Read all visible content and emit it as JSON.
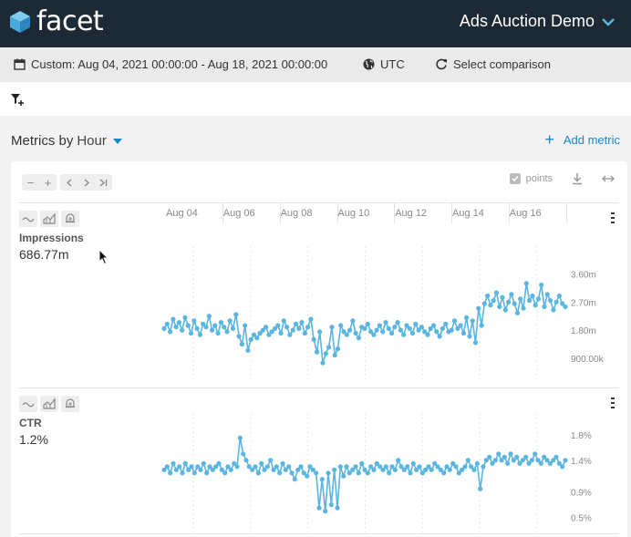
{
  "header": {
    "logo_text": "facet",
    "datacube_title": "Ads Auction Demo"
  },
  "timebar": {
    "range_label": "Custom: Aug 04, 2021 00:00:00 - Aug 18, 2021 00:00:00",
    "timezone": "UTC",
    "comparison_label": "Select comparison"
  },
  "metrics_header": {
    "title": "Metrics by",
    "split_dimension": "Hour",
    "add_metric_label": "Add metric"
  },
  "toolbar": {
    "points_label": "points"
  },
  "time_axis": {
    "labels": [
      "Aug 04",
      "Aug 06",
      "Aug 08",
      "Aug 10",
      "Aug 12",
      "Aug 14",
      "Aug 16"
    ]
  },
  "metrics": [
    {
      "name": "Impressions",
      "total": "686.77m",
      "chart_data": {
        "type": "line",
        "series_color": "#5ab5e0",
        "x_range": [
          "2021-08-04",
          "2021-08-18"
        ],
        "y_tick_labels": [
          "3.60m",
          "2.70m",
          "1.80m",
          "900.00k"
        ],
        "y_tick_values": [
          3600000,
          2700000,
          1800000,
          900000
        ],
        "ylim": [
          400000,
          4200000
        ],
        "values": [
          1850000,
          2000000,
          1750000,
          2150000,
          1900000,
          2050000,
          1800000,
          2200000,
          1950000,
          1700000,
          2100000,
          1850000,
          1650000,
          2000000,
          1900000,
          2250000,
          1800000,
          1950000,
          1700000,
          2050000,
          1900000,
          1750000,
          2100000,
          1850000,
          2300000,
          1600000,
          1350000,
          1950000,
          1150000,
          1500000,
          1650000,
          1550000,
          1700000,
          1800000,
          1900000,
          1650000,
          1750000,
          1850000,
          1950000,
          1700000,
          2100000,
          1900000,
          1650000,
          1800000,
          2000000,
          1850000,
          2050000,
          1700000,
          1900000,
          2150000,
          1500000,
          1100000,
          1750000,
          750000,
          1050000,
          1250000,
          1900000,
          1000000,
          1200000,
          1950000,
          1750000,
          1650000,
          1800000,
          2100000,
          1700000,
          1550000,
          1900000,
          1850000,
          2000000,
          1750000,
          1650000,
          1800000,
          1950000,
          1750000,
          2050000,
          1850000,
          1700000,
          1900000,
          2050000,
          1800000,
          1650000,
          1950000,
          1850000,
          1700000,
          2000000,
          1800000,
          1900000,
          1750000,
          1650000,
          1850000,
          1950000,
          1750000,
          1600000,
          1850000,
          2000000,
          1750000,
          1800000,
          2100000,
          1850000,
          1950000,
          1700000,
          2200000,
          1600000,
          2100000,
          1400000,
          2500000,
          1950000,
          2650000,
          2900000,
          2600000,
          2750000,
          3000000,
          2550000,
          2850000,
          2450000,
          2700000,
          2950000,
          2650000,
          2350000,
          2800000,
          2500000,
          3300000,
          2750000,
          2900000,
          2600000,
          2800000,
          3250000,
          2550000,
          2950000,
          2750000,
          2450000,
          2700000,
          2900000,
          2650000,
          2550000
        ]
      }
    },
    {
      "name": "CTR",
      "total": "1.2%",
      "chart_data": {
        "type": "line",
        "series_color": "#5ab5e0",
        "x_range": [
          "2021-08-04",
          "2021-08-18"
        ],
        "y_tick_labels": [
          "1.8%",
          "1.4%",
          "0.9%",
          "0.5%"
        ],
        "y_tick_values": [
          1.8,
          1.4,
          0.9,
          0.5
        ],
        "ylim": [
          0.35,
          2.0
        ],
        "values": [
          1.25,
          1.3,
          1.2,
          1.35,
          1.25,
          1.3,
          1.2,
          1.35,
          1.25,
          1.3,
          1.2,
          1.3,
          1.25,
          1.35,
          1.2,
          1.3,
          1.25,
          1.3,
          1.35,
          1.25,
          1.2,
          1.3,
          1.25,
          1.35,
          1.3,
          1.75,
          1.5,
          1.4,
          1.3,
          1.25,
          1.3,
          1.2,
          1.35,
          1.25,
          1.3,
          1.4,
          1.25,
          1.3,
          1.2,
          1.35,
          1.25,
          1.3,
          1.2,
          1.1,
          1.25,
          1.3,
          1.2,
          1.15,
          1.3,
          1.25,
          1.2,
          0.65,
          1.1,
          0.6,
          1.2,
          0.7,
          1.25,
          0.65,
          1.3,
          1.15,
          1.3,
          1.2,
          1.25,
          1.3,
          1.2,
          1.35,
          1.25,
          1.2,
          1.3,
          1.25,
          1.35,
          1.3,
          1.25,
          1.3,
          1.2,
          1.3,
          1.25,
          1.4,
          1.3,
          1.25,
          1.3,
          1.2,
          1.35,
          1.25,
          1.3,
          1.2,
          1.25,
          1.3,
          1.25,
          1.35,
          1.3,
          1.25,
          1.2,
          1.3,
          1.25,
          1.35,
          1.3,
          1.2,
          1.25,
          1.3,
          1.4,
          1.3,
          1.25,
          1.35,
          0.95,
          1.3,
          1.4,
          1.45,
          1.35,
          1.4,
          1.5,
          1.4,
          1.45,
          1.35,
          1.5,
          1.4,
          1.45,
          1.35,
          1.4,
          1.45,
          1.35,
          1.4,
          1.5,
          1.4,
          1.35,
          1.45,
          1.4,
          1.35,
          1.4,
          1.45,
          1.35,
          1.3,
          1.4
        ]
      }
    }
  ]
}
